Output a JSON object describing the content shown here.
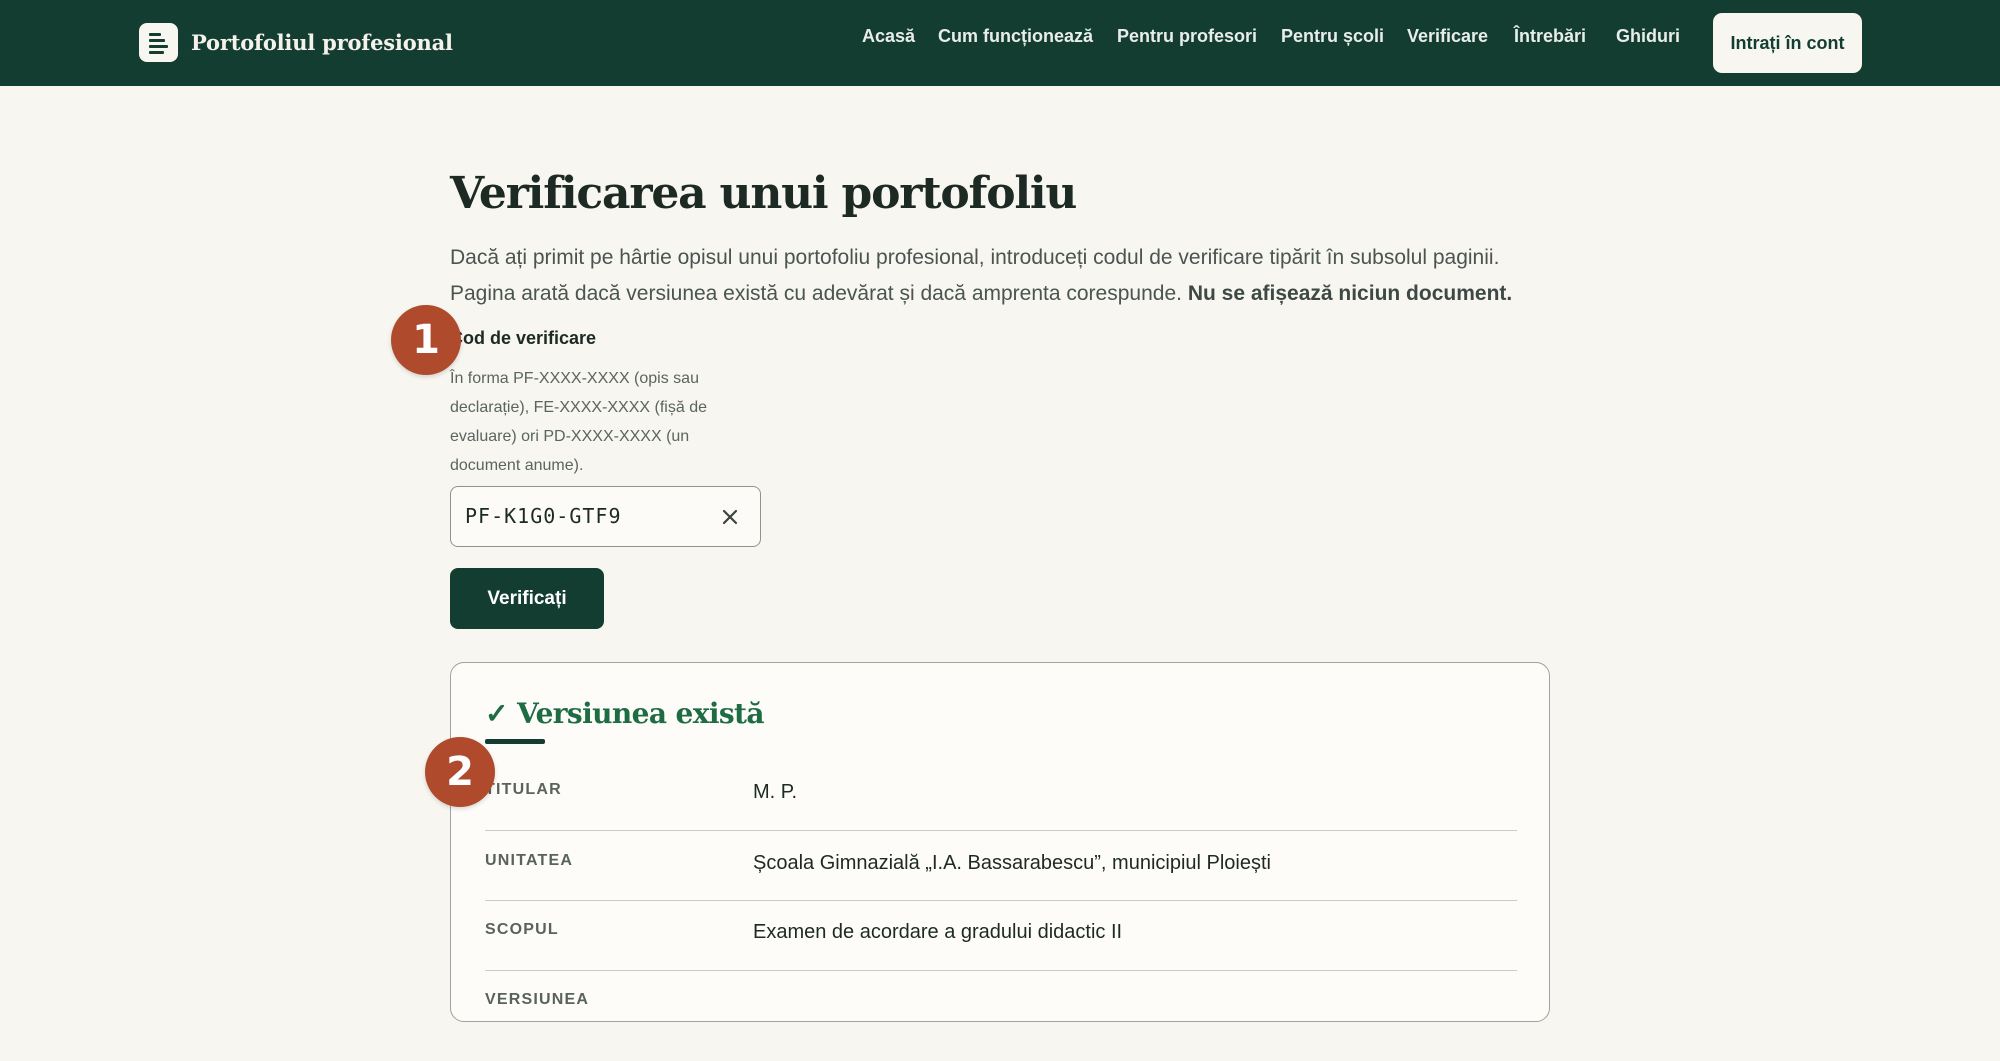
{
  "header": {
    "brand_title": "Portofoliul profesional",
    "nav": [
      "Acasă",
      "Cum funcționează",
      "Pentru profesori",
      "Pentru școli",
      "Verificare",
      "Întrebări",
      "Ghiduri"
    ],
    "login_label": "Intrați în cont"
  },
  "main": {
    "title": "Verificarea unui portofoliu",
    "intro_text": "Dacă ați primit pe hârtie opisul unui portofoliu profesional, introduceți codul de verificare tipărit în subsolul paginii. Pagina arată dacă versiunea există cu adevărat și dacă amprenta corespunde.",
    "intro_bold": "Nu se afișează niciun document.",
    "field_label": "Cod de verificare",
    "field_hint": "În forma PF-XXXX-XXXX (opis sau declarație), FE-XXXX-XXXX (fișă de evaluare) ori PD-XXXX-XXXX (un document anume).",
    "code_value": "PF-K1G0-GTF9",
    "verify_label": "Verificați"
  },
  "result": {
    "title": "✓ Versiunea există",
    "rows": [
      {
        "key": "TITULAR",
        "value": "M. P."
      },
      {
        "key": "UNITATEA",
        "value": "Școala Gimnazială „I.A. Bassarabescu”, municipiul Ploiești"
      },
      {
        "key": "SCOPUL",
        "value": "Examen de acordare a gradului didactic II"
      },
      {
        "key": "VERSIUNEA",
        "value": ""
      }
    ]
  },
  "markers": [
    "1",
    "2"
  ],
  "colors": {
    "header_bg": "#143d32",
    "accent_green": "#1f6b44",
    "marker": "#b04a2c",
    "page_bg": "#f7f6f1"
  }
}
